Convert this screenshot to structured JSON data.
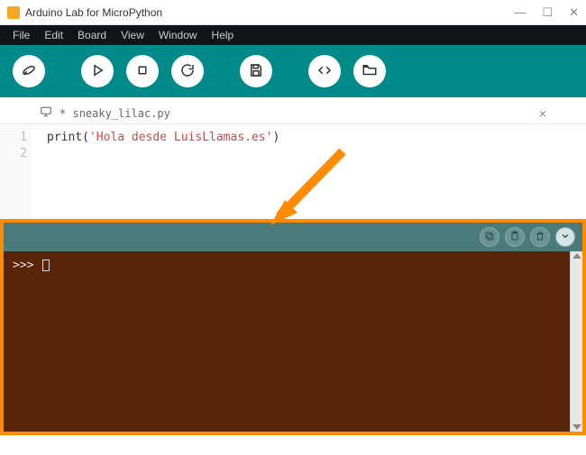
{
  "window": {
    "title": "Arduino Lab for MicroPython"
  },
  "menu": {
    "items": [
      "File",
      "Edit",
      "Board",
      "View",
      "Window",
      "Help"
    ]
  },
  "toolbar": {
    "buttons": [
      "connect",
      "run",
      "stop",
      "reset",
      "save",
      "code",
      "open"
    ]
  },
  "tab": {
    "modified_marker": "*",
    "filename": "sneaky_lilac.py"
  },
  "editor": {
    "line_numbers": [
      "1",
      "2"
    ],
    "code_fn": "print",
    "code_paren_open": "(",
    "code_string": "'Hola desde LuisLlamas.es'",
    "code_paren_close": ")"
  },
  "repl": {
    "prompt": ">>>",
    "header_buttons": [
      "copy",
      "paste",
      "trash",
      "collapse"
    ]
  },
  "colors": {
    "toolbar_bg": "#008a8a",
    "repl_bg": "#5a2408",
    "highlight_border": "#ff8c00",
    "arrow": "#ff8c00"
  }
}
